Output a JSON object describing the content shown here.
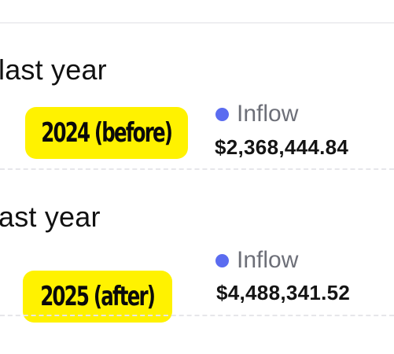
{
  "colors": {
    "badge_background": "#fff200",
    "inflow_dot": "#5b6cf0",
    "legend_text": "#6d6f78",
    "divider": "#eeeef1"
  },
  "cards": [
    {
      "period_title": "last year",
      "badge": "2024 (before)",
      "legend": {
        "icon": "dot-icon",
        "label": "Inflow"
      },
      "amount": "$2,368,444.84"
    },
    {
      "period_title": "ast year",
      "badge": "2025 (after)",
      "legend": {
        "icon": "dot-icon",
        "label": "Inflow"
      },
      "amount": "$4,488,341.52"
    }
  ]
}
